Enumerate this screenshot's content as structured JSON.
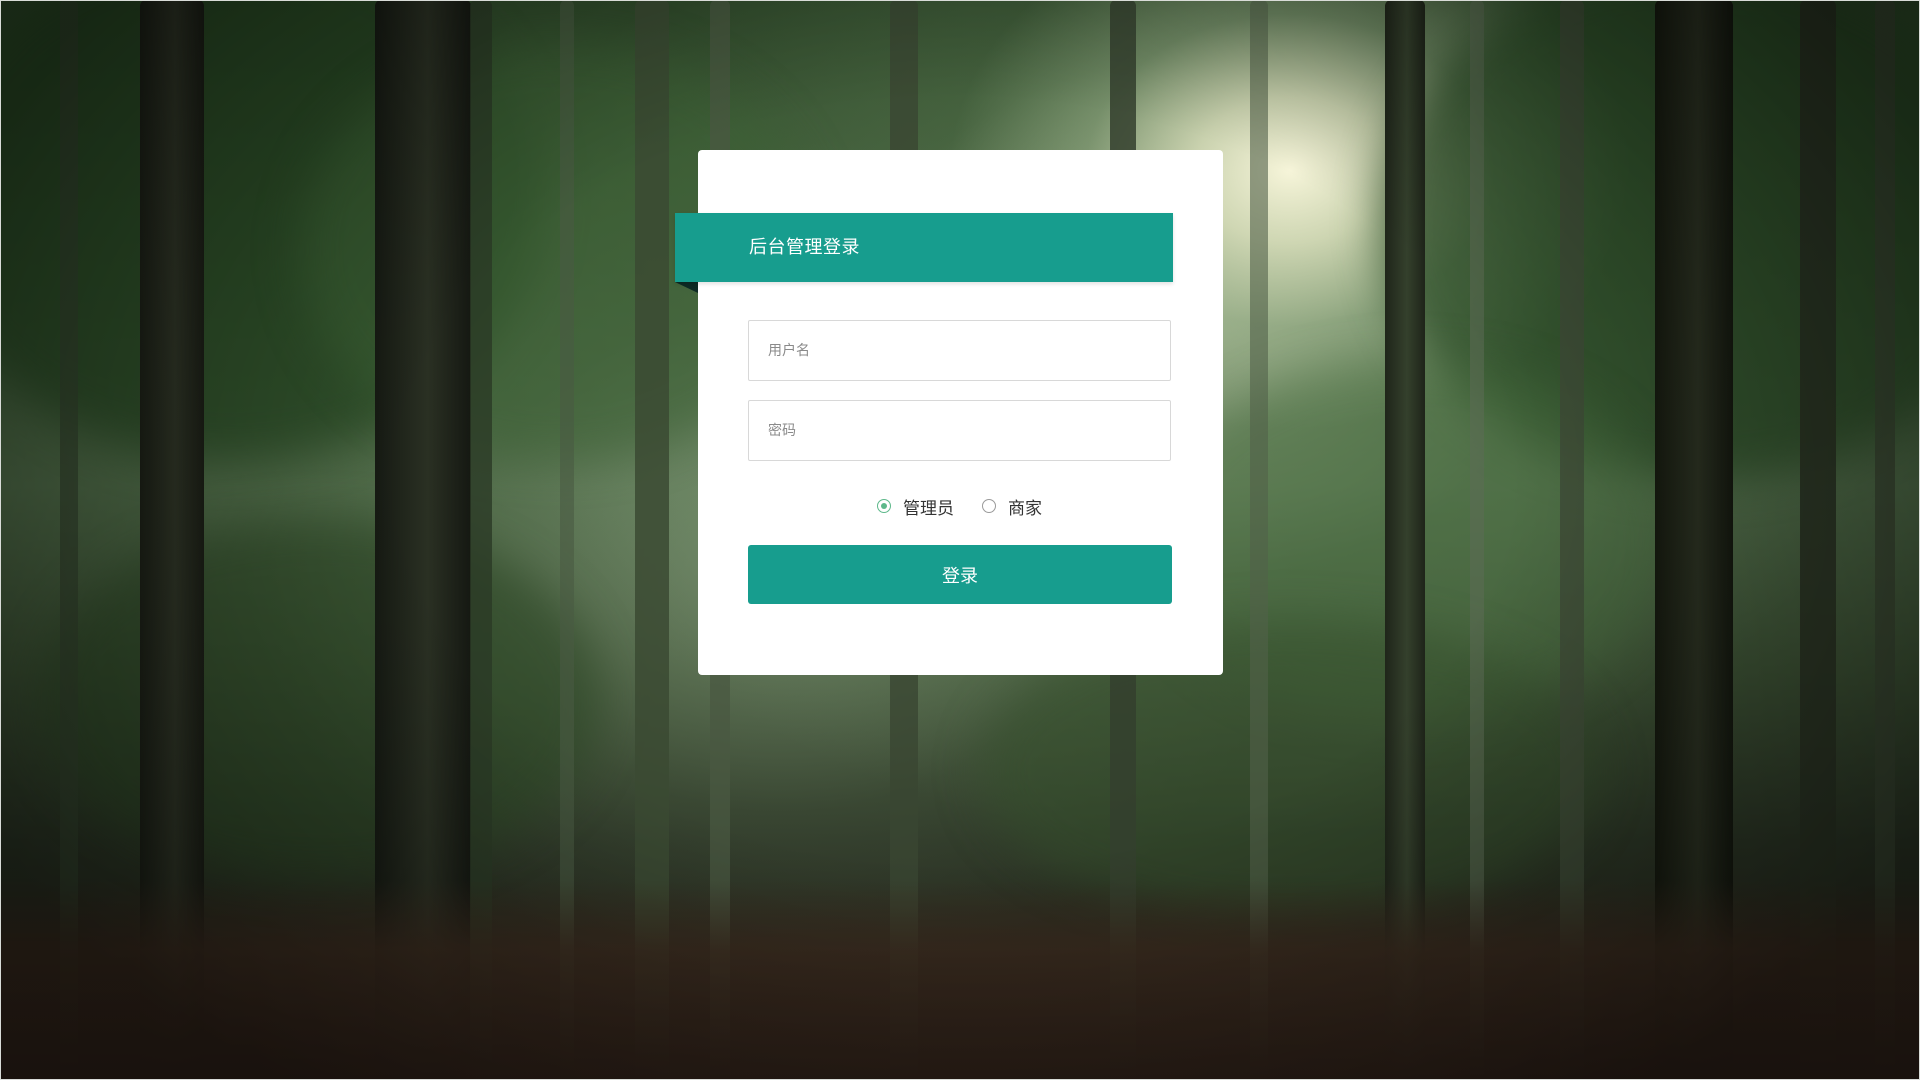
{
  "login": {
    "title": "后台管理登录",
    "username_placeholder": "用户名",
    "username_value": "",
    "password_placeholder": "密码",
    "password_value": "",
    "roles": [
      {
        "label": "管理员",
        "selected": true
      },
      {
        "label": "商家",
        "selected": false
      }
    ],
    "submit_label": "登录"
  },
  "colors": {
    "accent": "#179d8e",
    "radio_checked": "#5db88a",
    "card_background": "#ffffff"
  }
}
